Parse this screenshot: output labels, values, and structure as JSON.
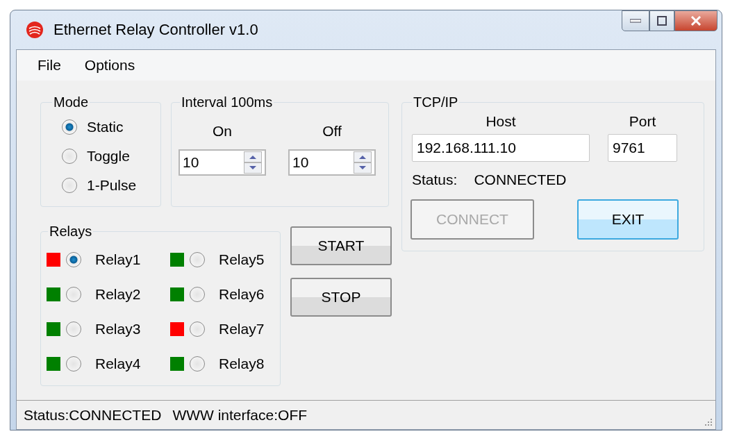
{
  "window": {
    "title": "Ethernet Relay Controller v1.0"
  },
  "menu": [
    "File",
    "Options"
  ],
  "mode": {
    "title": "Mode",
    "options": [
      {
        "label": "Static",
        "selected": true
      },
      {
        "label": "Toggle",
        "selected": false
      },
      {
        "label": "1-Pulse",
        "selected": false
      }
    ]
  },
  "interval": {
    "title": "Interval 100ms",
    "on": {
      "label": "On",
      "value": "10"
    },
    "off": {
      "label": "Off",
      "value": "10"
    }
  },
  "relays": {
    "title": "Relays",
    "items": [
      {
        "label": "Relay1",
        "selected": true,
        "color": "#ff0000"
      },
      {
        "label": "Relay2",
        "selected": false,
        "color": "#008000"
      },
      {
        "label": "Relay3",
        "selected": false,
        "color": "#008000"
      },
      {
        "label": "Relay4",
        "selected": false,
        "color": "#008000"
      },
      {
        "label": "Relay5",
        "selected": false,
        "color": "#008000"
      },
      {
        "label": "Relay6",
        "selected": false,
        "color": "#008000"
      },
      {
        "label": "Relay7",
        "selected": false,
        "color": "#ff0000"
      },
      {
        "label": "Relay8",
        "selected": false,
        "color": "#008000"
      }
    ]
  },
  "actions": [
    {
      "label": "START",
      "disabled": false
    },
    {
      "label": "STOP",
      "disabled": false
    }
  ],
  "tcp": {
    "title": "TCP/IP",
    "host": {
      "label": "Host",
      "value": "192.168.111.10"
    },
    "port": {
      "label": "Port",
      "value": "9761"
    },
    "status_label": "Status:",
    "status_value": "CONNECTED",
    "buttons": [
      {
        "label": "CONNECT",
        "disabled": true,
        "focused": false
      },
      {
        "label": "EXIT",
        "disabled": false,
        "focused": true
      }
    ]
  },
  "status_bar": [
    "Status:CONNECTED",
    "WWW interface:OFF"
  ]
}
